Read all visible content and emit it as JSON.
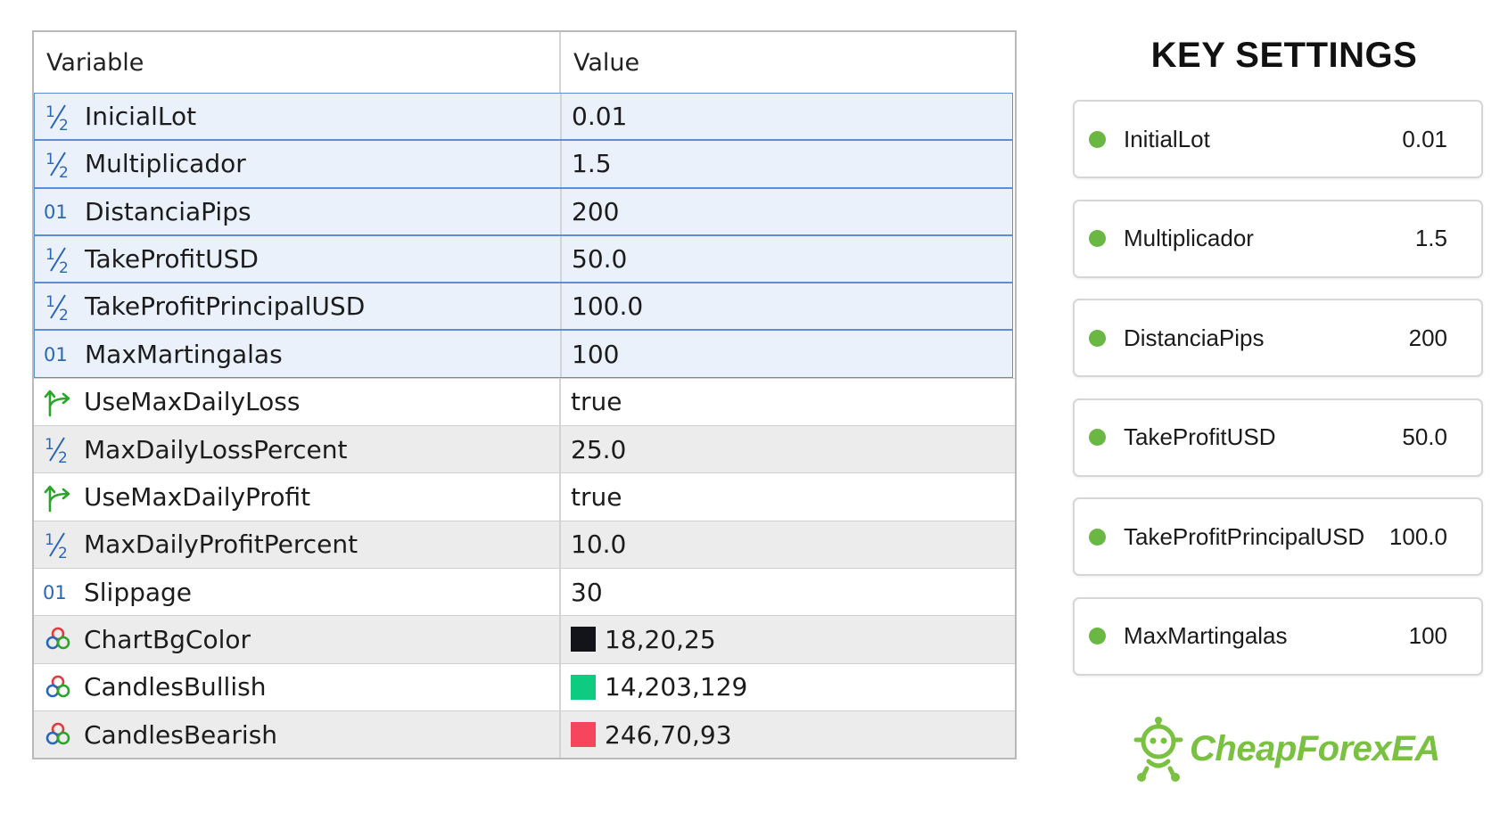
{
  "table": {
    "header": {
      "variable": "Variable",
      "value": "Value"
    },
    "rows": [
      {
        "icon": "fraction-icon",
        "type": "double",
        "name": "InicialLot",
        "value": "0.01",
        "selected": true
      },
      {
        "icon": "fraction-icon",
        "type": "double",
        "name": "Multiplicador",
        "value": "1.5",
        "selected": true
      },
      {
        "icon": "integer-icon",
        "type": "int",
        "name": "DistanciaPips",
        "value": "200",
        "selected": true
      },
      {
        "icon": "fraction-icon",
        "type": "double",
        "name": "TakeProfitUSD",
        "value": "50.0",
        "selected": true
      },
      {
        "icon": "fraction-icon",
        "type": "double",
        "name": "TakeProfitPrincipalUSD",
        "value": "100.0",
        "selected": true
      },
      {
        "icon": "integer-icon",
        "type": "int",
        "name": "MaxMartingalas",
        "value": "100",
        "selected": true
      },
      {
        "icon": "bool-arrow-icon",
        "type": "bool",
        "name": "UseMaxDailyLoss",
        "value": "true",
        "selected": false
      },
      {
        "icon": "fraction-icon",
        "type": "double",
        "name": "MaxDailyLossPercent",
        "value": "25.0",
        "selected": false
      },
      {
        "icon": "bool-arrow-icon",
        "type": "bool",
        "name": "UseMaxDailyProfit",
        "value": "true",
        "selected": false
      },
      {
        "icon": "fraction-icon",
        "type": "double",
        "name": "MaxDailyProfitPercent",
        "value": "10.0",
        "selected": false
      },
      {
        "icon": "integer-icon",
        "type": "int",
        "name": "Slippage",
        "value": "30",
        "selected": false
      },
      {
        "icon": "color-circles-icon",
        "type": "color",
        "name": "ChartBgColor",
        "value": "18,20,25",
        "swatch": "#121419",
        "selected": false
      },
      {
        "icon": "color-circles-icon",
        "type": "color",
        "name": "CandlesBullish",
        "value": "14,203,129",
        "swatch": "#0ecb81",
        "selected": false
      },
      {
        "icon": "color-circles-icon",
        "type": "color",
        "name": "CandlesBearish",
        "value": "246,70,93",
        "swatch": "#f6465d",
        "selected": false
      }
    ]
  },
  "key_settings": {
    "title": "KEY SETTINGS",
    "items": [
      {
        "label": "InitialLot",
        "value": "0.01"
      },
      {
        "label": "Multiplicador",
        "value": "1.5"
      },
      {
        "label": "DistanciaPips",
        "value": "200"
      },
      {
        "label": "TakeProfitUSD",
        "value": "50.0"
      },
      {
        "label": "TakeProfitPrincipalUSD",
        "value": "100.0"
      },
      {
        "label": "MaxMartingalas",
        "value": "100"
      }
    ]
  },
  "logo": {
    "text": "CheapForexEA",
    "icon": "robot-mascot-icon"
  },
  "colors": {
    "selected_row_bg": "#eaf1fb",
    "selected_row_border": "#5b8ed6",
    "alt_row_bg": "#ececec",
    "status_dot": "#6bb744",
    "brand_green": "#7ac142",
    "type_blue": "#2a66b8",
    "bool_green": "#2aa52a"
  }
}
